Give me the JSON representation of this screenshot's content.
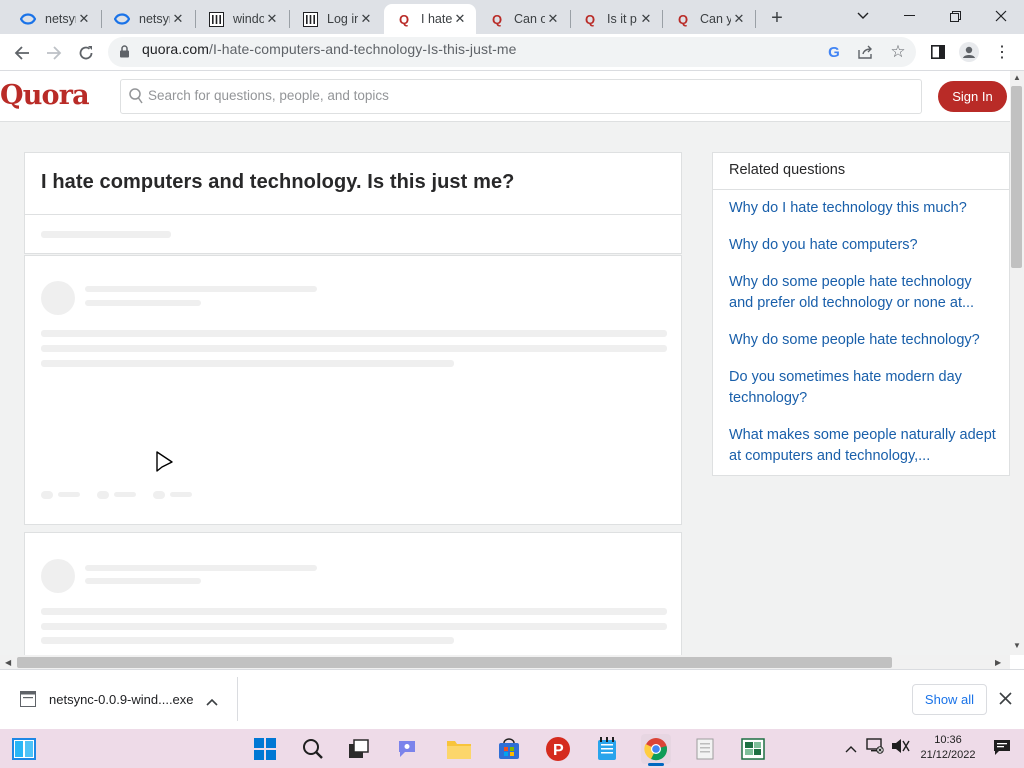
{
  "browser": {
    "tabs": [
      {
        "title": "netsync",
        "icon": "netsync-favicon",
        "active": false
      },
      {
        "title": "netsync",
        "icon": "netsync-favicon",
        "active": false
      },
      {
        "title": "windows",
        "icon": "bank-favicon",
        "active": false
      },
      {
        "title": "Log in",
        "icon": "bank-favicon",
        "active": false
      },
      {
        "title": "I hate",
        "icon": "quora-favicon",
        "active": true
      },
      {
        "title": "Can o",
        "icon": "quora-favicon",
        "active": false
      },
      {
        "title": "Is it p",
        "icon": "quora-favicon",
        "active": false
      },
      {
        "title": "Can y",
        "icon": "quora-favicon",
        "active": false
      }
    ],
    "new_tab_label": "+",
    "url_host": "quora.com",
    "url_path": "/I-hate-computers-and-technology-Is-this-just-me"
  },
  "quora": {
    "logo": "Quora",
    "search_placeholder": "Search for questions, people, and topics",
    "signin_label": "Sign In",
    "question_title": "I hate computers and technology. Is this just me?",
    "related_title": "Related questions",
    "related_questions": [
      "Why do I hate technology this much?",
      "Why do you hate computers?",
      "Why do some people hate technology and prefer old technology or none at...",
      "Why do some people hate technology?",
      "Do you sometimes hate modern day technology?",
      "What makes some people naturally adept at computers and technology,..."
    ]
  },
  "downloads": {
    "filename": "netsync-0.0.9-wind....exe",
    "show_all_label": "Show all"
  },
  "taskbar": {
    "time": "10:36",
    "date": "21/12/2022"
  },
  "colors": {
    "quora_red": "#b92b27",
    "link_blue": "#195faa",
    "chrome_blue": "#1a73e8"
  }
}
